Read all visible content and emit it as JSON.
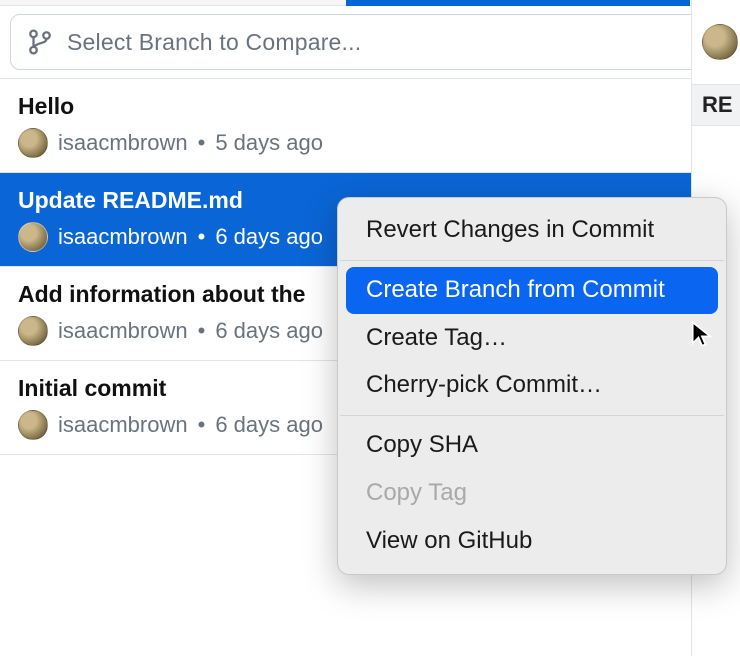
{
  "branch_selector": {
    "placeholder": "Select Branch to Compare..."
  },
  "right_pane": {
    "label": "RE"
  },
  "commits": [
    {
      "title": "Hello",
      "author": "isaacmbrown",
      "time": "5 days ago",
      "selected": false
    },
    {
      "title": "Update README.md",
      "author": "isaacmbrown",
      "time": "6 days ago",
      "selected": true
    },
    {
      "title": "Add information about the",
      "author": "isaacmbrown",
      "time": "6 days ago",
      "selected": false
    },
    {
      "title": "Initial commit",
      "author": "isaacmbrown",
      "time": "6 days ago",
      "selected": false
    }
  ],
  "context_menu": {
    "items": [
      {
        "label": "Revert Changes in Commit",
        "kind": "item"
      },
      {
        "kind": "sep"
      },
      {
        "label": "Create Branch from Commit",
        "kind": "item",
        "highlight": true
      },
      {
        "label": "Create Tag…",
        "kind": "item"
      },
      {
        "label": "Cherry-pick Commit…",
        "kind": "item"
      },
      {
        "kind": "sep"
      },
      {
        "label": "Copy SHA",
        "kind": "item"
      },
      {
        "label": "Copy Tag",
        "kind": "item",
        "disabled": true
      },
      {
        "label": "View on GitHub",
        "kind": "item"
      }
    ]
  }
}
